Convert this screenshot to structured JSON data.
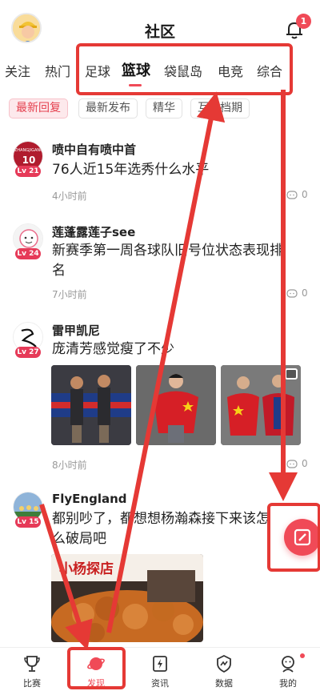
{
  "header": {
    "title": "社区",
    "notification_count": "1"
  },
  "tabs": [
    {
      "label": "关注"
    },
    {
      "label": "热门"
    },
    {
      "label": "足球"
    },
    {
      "label": "篮球"
    },
    {
      "label": "袋鼠岛"
    },
    {
      "label": "电竞"
    },
    {
      "label": "综合"
    }
  ],
  "active_tab": "篮球",
  "filters": [
    {
      "label": "最新回复"
    },
    {
      "label": "最新发布"
    },
    {
      "label": "精华"
    },
    {
      "label": "互动档期"
    }
  ],
  "posts": [
    {
      "author": "喷中自有喷中首",
      "level": "Lv 21",
      "text": "76人近15年选秀什么水平",
      "time": "4小时前",
      "comments": "0"
    },
    {
      "author": "莲蓬露莲子see",
      "level": "Lv 24",
      "text": "新赛季第一周各球队旧号位状态表现排名",
      "time": "7小时前",
      "comments": "0"
    },
    {
      "author": "雷甲凯尼",
      "level": "Lv 27",
      "text": "庞清芳感觉瘦了不少",
      "time": "8小时前",
      "comments": "0"
    },
    {
      "author": "FlyEngland",
      "level": "Lv 15",
      "text": "都别吵了，都想想杨瀚森接下来该怎么破局吧",
      "time": "",
      "comments": ""
    }
  ],
  "post4_image_caption": "小杨探店",
  "bottom_nav": [
    {
      "label": "比赛",
      "icon": "trophy-icon"
    },
    {
      "label": "发现",
      "icon": "planet-icon"
    },
    {
      "label": "资讯",
      "icon": "news-bolt-icon"
    },
    {
      "label": "数据",
      "icon": "data-shield-icon"
    },
    {
      "label": "我的",
      "icon": "profile-icon"
    }
  ],
  "colors": {
    "accent": "#f04a57",
    "annotation": "#e53935"
  }
}
